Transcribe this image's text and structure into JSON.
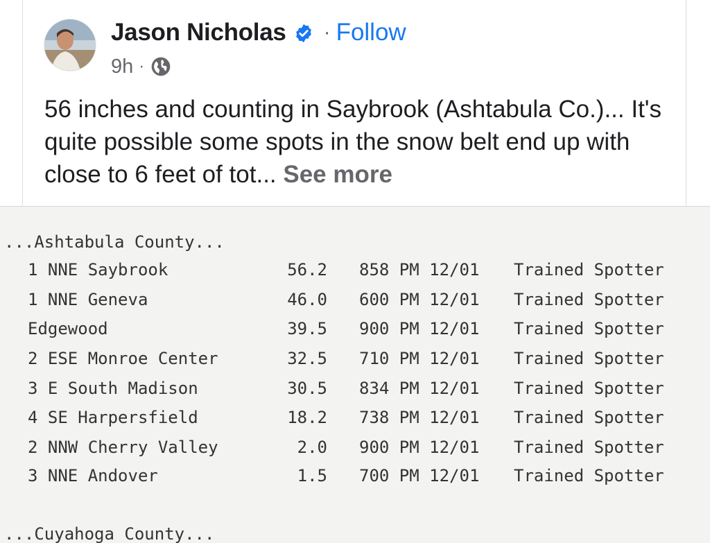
{
  "post": {
    "author": "Jason Nicholas",
    "follow_separator": "·",
    "follow_label": "Follow",
    "timestamp": "9h",
    "meta_separator": "·",
    "verified_color": "#1877f2",
    "visibility_icon": "globe-icon",
    "text": "56 inches and counting in Saybrook (Ashtabula Co.)... It's quite possible some spots in the snow belt end up with close to 6 feet of tot...",
    "see_more_label": "See more"
  },
  "report": {
    "county_1": "...Ashtabula County...",
    "rows": [
      {
        "location": "1 NNE Saybrook",
        "amount": "56.2",
        "time": "858 PM 12/01",
        "source": "Trained Spotter"
      },
      {
        "location": "1 NNE Geneva",
        "amount": "46.0",
        "time": "600 PM 12/01",
        "source": "Trained Spotter"
      },
      {
        "location": "Edgewood",
        "amount": "39.5",
        "time": "900 PM 12/01",
        "source": "Trained Spotter"
      },
      {
        "location": "2 ESE Monroe Center",
        "amount": "32.5",
        "time": "710 PM 12/01",
        "source": "Trained Spotter"
      },
      {
        "location": "3 E South Madison",
        "amount": "30.5",
        "time": "834 PM 12/01",
        "source": "Trained Spotter"
      },
      {
        "location": "4 SE Harpersfield",
        "amount": "18.2",
        "time": "738 PM 12/01",
        "source": "Trained Spotter"
      },
      {
        "location": "2 NNW Cherry Valley",
        "amount": "2.0",
        "time": "900 PM 12/01",
        "source": "Trained Spotter"
      },
      {
        "location": "3 NNE Andover",
        "amount": "1.5",
        "time": "700 PM 12/01",
        "source": "Trained Spotter"
      }
    ],
    "county_2": "...Cuyahoga County..."
  }
}
